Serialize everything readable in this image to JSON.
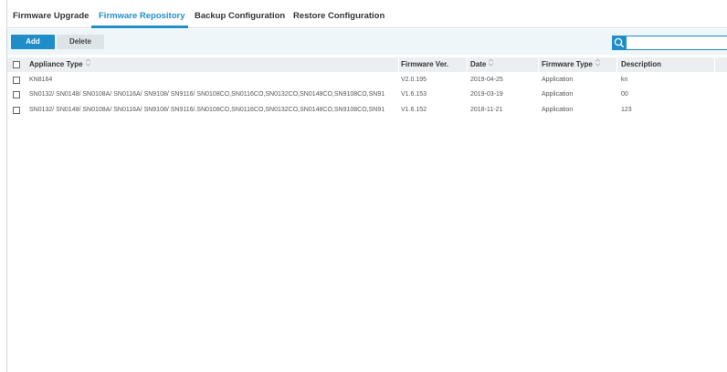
{
  "tabs": [
    {
      "label": "Firmware Upgrade",
      "active": false
    },
    {
      "label": "Firmware Repository",
      "active": true
    },
    {
      "label": "Backup Configuration",
      "active": false
    },
    {
      "label": "Restore Configuration",
      "active": false
    }
  ],
  "toolbar": {
    "add_label": "Add",
    "delete_label": "Delete",
    "search_placeholder": ""
  },
  "table": {
    "columns": [
      {
        "label": "Appliance Type",
        "sortable": true
      },
      {
        "label": "Firmware Ver.",
        "sortable": false
      },
      {
        "label": "Date",
        "sortable": true
      },
      {
        "label": "Firmware Type",
        "sortable": true
      },
      {
        "label": "Description",
        "sortable": false
      }
    ],
    "rows": [
      {
        "appliance": "KN8164",
        "version": "V2.0.195",
        "date": "2019-04-25",
        "type": "Application",
        "description": "kn"
      },
      {
        "appliance": "SN0132/ SN0148/ SN0108A/ SN0116A/ SN9108/ SN9116/ SN0108CO,SN0116CO,SN0132CO,SN0148CO,SN9108CO,SN91",
        "version": "V1.6.153",
        "date": "2019-03-19",
        "type": "Application",
        "description": "00"
      },
      {
        "appliance": "SN0132/ SN0148/ SN0108A/ SN0116A/ SN9108/ SN9116/.SN0108CO,SN0116CO,SN0132CO,SN0148CO,SN9108CO,SN91",
        "version": "V1.6.152",
        "date": "2018-11-21",
        "type": "Application",
        "description": "123"
      }
    ]
  },
  "colors": {
    "accent": "#1f8fc9",
    "toolbar_bg": "#eef6f9",
    "header_bg": "#eceff1"
  }
}
